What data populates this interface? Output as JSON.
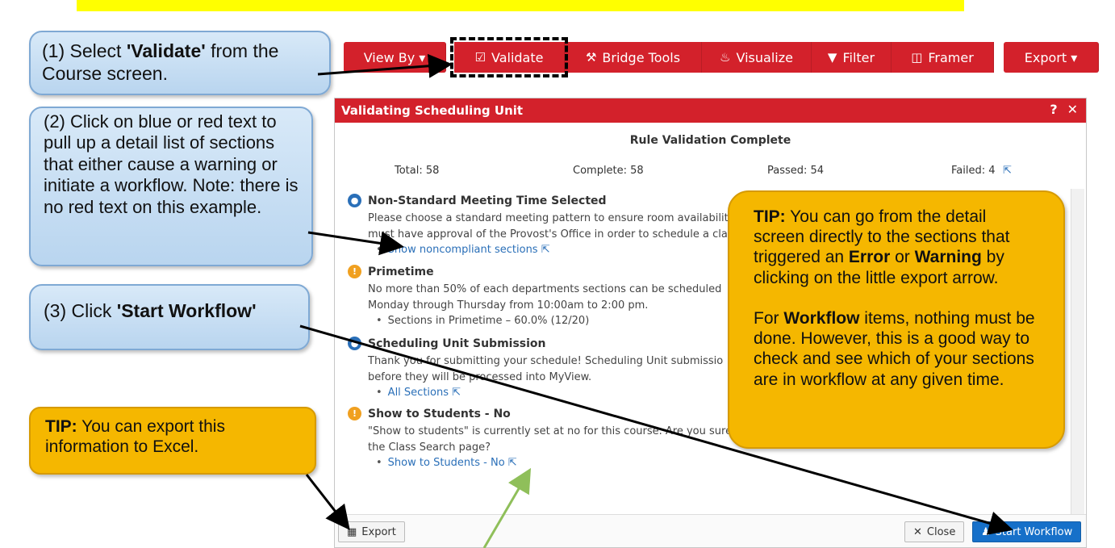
{
  "colors": {
    "toolbar_red": "#d3212b",
    "dialog_header_red": "#d3212b",
    "link_blue": "#2a6fb8",
    "primary_blue": "#1670c9",
    "callout_blue": "#c8def4",
    "callout_yellow": "#f5b700",
    "banner_yellow": "#ffff00",
    "green_arrow": "#8fbf5a"
  },
  "toolbar": {
    "view_by": "View By ▾",
    "validate": "Validate",
    "bridge_tools": "Bridge Tools",
    "visualize": "Visualize",
    "filter": "Filter",
    "framer": "Framer",
    "export": "Export ▾"
  },
  "callouts": {
    "step1_prefix": "(1) Select ",
    "step1_bold": "'Validate'",
    "step1_suffix": " from the Course screen.",
    "step2_text": "(2) Click on blue or red text to pull up a detail list of sections that either cause a warning or initiate a workflow. Note: there is no red text on this example.",
    "step3_prefix": "(3) Click ",
    "step3_bold": "'Start Workflow'",
    "tip_export_bold": "TIP:",
    "tip_export_text": " You can export this information to Excel.",
    "tip_detail_bold": "TIP:",
    "tip_detail_text1": " You can go from the detail screen directly to the sections that triggered an ",
    "tip_detail_error": "Error",
    "tip_detail_or": " or ",
    "tip_detail_warning": "Warning",
    "tip_detail_text2": " by clicking on the little export arrow.",
    "tip_detail_for": "For ",
    "tip_detail_workflow": "Workflow",
    "tip_detail_text3": " items, nothing must be done. However, this is a good way to check and see which of your sections are in workflow at any given time."
  },
  "dialog": {
    "title": "Validating Scheduling Unit",
    "subtitle": "Rule Validation Complete",
    "total": "Total: 58",
    "complete": "Complete: 58",
    "passed": "Passed: 54",
    "failed": "Failed: 4",
    "rules": [
      {
        "title": "Non-Standard Meeting Time Selected",
        "desc1": "Please choose a standard meeting pattern to ensure room availabilit",
        "desc2": "must have approval of the Provost's Office in order to schedule a cla",
        "link": "Show noncompliant sections",
        "icon": "people-icon"
      },
      {
        "title": "Primetime",
        "desc1": "No more than 50% of each departments sections can be scheduled",
        "desc2": "Monday through Thursday from 10:00am to 2:00 pm.",
        "link": "Sections in Primetime – 60.0% (12/20)",
        "icon": "exclamation-icon"
      },
      {
        "title": "Scheduling Unit Submission",
        "desc1": "Thank you for submitting your schedule! Scheduling Unit submissio",
        "desc2": "before they will be processed into MyView.",
        "link": "All Sections",
        "icon": "people-icon"
      },
      {
        "title": "Show to Students - No",
        "desc1": "\"Show to students\" is currently set at no for this course. Are you sure y",
        "desc2": "the Class Search page?",
        "link": "Show to Students - No",
        "icon": "exclamation-icon"
      }
    ],
    "footer": {
      "export": "Export",
      "close": "Close",
      "start_workflow": "Start Workflow"
    }
  }
}
